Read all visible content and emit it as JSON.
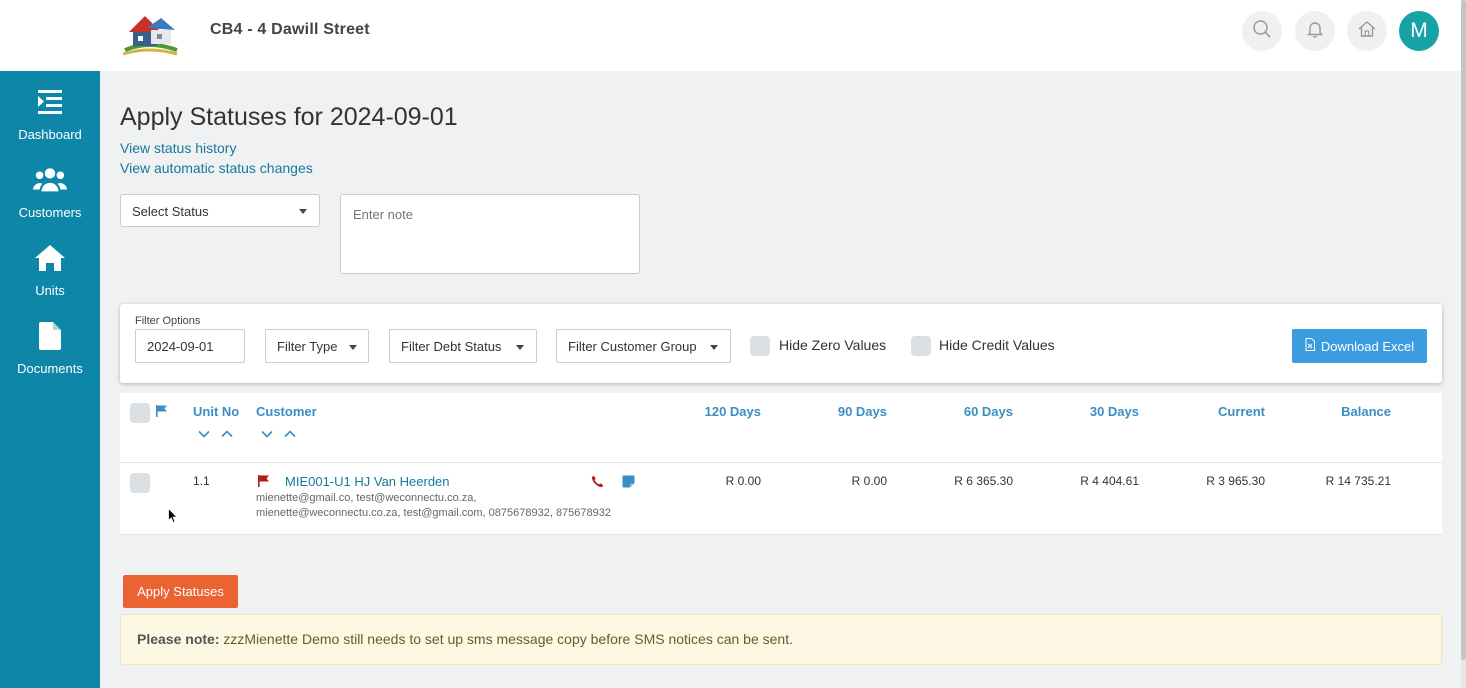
{
  "header": {
    "site_title": "CB4 - 4 Dawill Street",
    "avatar_letter": "M",
    "icons": [
      "search-icon",
      "bell-icon",
      "home-icon"
    ]
  },
  "sidebar": {
    "items": [
      {
        "label": "Dashboard",
        "icon": "dashboard-icon"
      },
      {
        "label": "Customers",
        "icon": "users-icon"
      },
      {
        "label": "Units",
        "icon": "home-icon"
      },
      {
        "label": "Documents",
        "icon": "file-icon"
      }
    ]
  },
  "main": {
    "title": "Apply Statuses for 2024-09-01",
    "links": {
      "history": "View status history",
      "automatic": "View automatic status changes"
    },
    "status_select": "Select Status",
    "note_placeholder": "Enter note"
  },
  "filters": {
    "label": "Filter Options",
    "date": "2024-09-01",
    "type": "Filter Type",
    "debt_status": "Filter Debt Status",
    "customer_group": "Filter Customer Group",
    "hide_zero": "Hide Zero Values",
    "hide_credit": "Hide Credit Values",
    "download": "Download Excel"
  },
  "table": {
    "columns": {
      "unit_no": "Unit No",
      "customer": "Customer",
      "d120": "120 Days",
      "d90": "90 Days",
      "d60": "60 Days",
      "d30": "30 Days",
      "current": "Current",
      "balance": "Balance"
    },
    "rows": [
      {
        "unit_no": "1.1",
        "customer": "MIE001-U1 HJ Van Heerden",
        "contact_line1": "mienette@gmail.co, test@weconnectu.co.za,",
        "contact_line2": "mienette@weconnectu.co.za, test@gmail.com, 0875678932, 875678932",
        "d120": "R 0.00",
        "d90": "R 0.00",
        "d60": "R 6 365.30",
        "d30": "R 4 404.61",
        "current": "R 3 965.30",
        "balance": "R 14 735.21"
      }
    ]
  },
  "actions": {
    "apply": "Apply Statuses"
  },
  "alert": {
    "strong": "Please note:",
    "text": " zzzMienette Demo still needs to set up sms message copy before SMS notices can be sent."
  },
  "colors": {
    "sidebar": "#0e86a8",
    "accent": "#3b8ec4",
    "apply_button": "#eb6333",
    "excel_button": "#3b9de0",
    "avatar": "#17a2a6"
  }
}
